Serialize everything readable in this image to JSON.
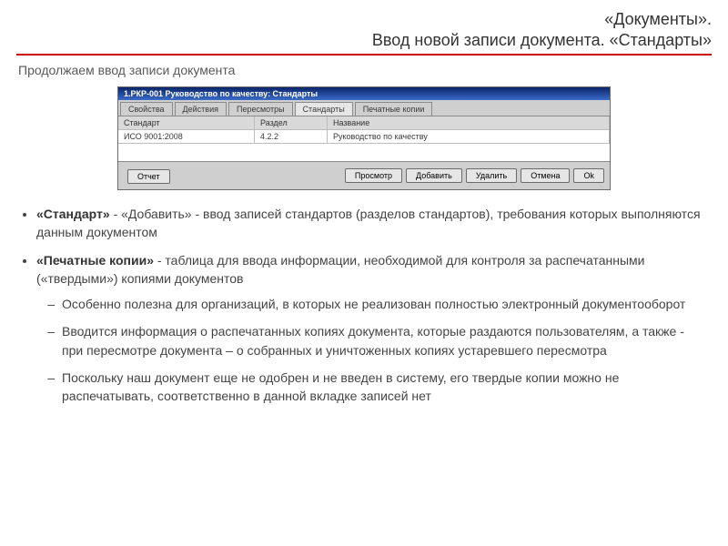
{
  "header": {
    "line1": "«Документы».",
    "line2": "Ввод новой записи документа. «Стандарты»"
  },
  "subtitle": "Продолжаем ввод записи документа",
  "window": {
    "title": "1.РКР-001 Руководство по качеству: Стандарты",
    "tabs": [
      "Свойства",
      "Действия",
      "Пересмотры",
      "Стандарты",
      "Печатные копии"
    ],
    "activeTabIndex": 3,
    "columns": {
      "c1": "Стандарт",
      "c2": "Раздел",
      "c3": "Название"
    },
    "row": {
      "c1": "ИСО 9001:2008",
      "c2": "4.2.2",
      "c3": "Руководство по качеству"
    },
    "footer": {
      "left": "Отчет",
      "right": [
        "Просмотр",
        "Добавить",
        "Удалить",
        "Отмена",
        "Ok"
      ]
    }
  },
  "content": {
    "b1_bold": "«Стандарт»",
    "b1_rest": " - «Добавить» - ввод записей стандартов (разделов стандартов), требования которых выполняются данным документом",
    "b2_bold": "«Печатные копии»",
    "b2_rest": " - таблица для ввода информации, необходимой для контроля за распечатанными («твердыми») копиями документов",
    "sub": [
      "Особенно полезна для организаций, в которых не реализован полностью электронный документооборот",
      "Вводится информация о распечатанных копиях документа, которые раздаются пользователям, а также  - при пересмотре документа – о собранных и уничтоженных копиях устаревшего пересмотра",
      "Поскольку наш документ еще не одобрен и не введен в систему, его твердые копии можно не распечатывать, соответственно в данной вкладке записей нет"
    ]
  }
}
